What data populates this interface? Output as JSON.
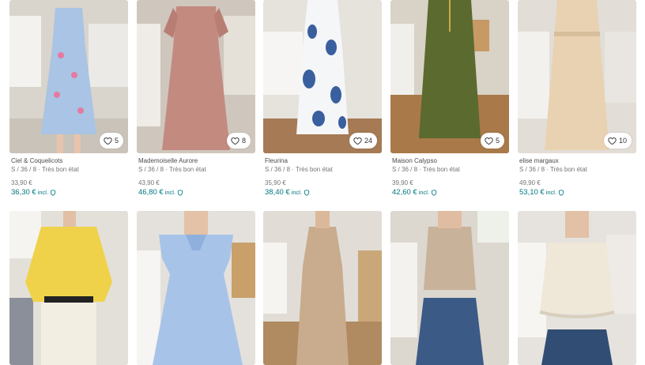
{
  "accent_color": "#007782",
  "items": [
    {
      "brand": "Ciel & Coquelicots",
      "details": "S / 36 / 8 · Très bon état",
      "price": "33,90 €",
      "price_incl": "36,30 €",
      "incl_label": "incl.",
      "favorites": "5",
      "colors": {
        "bg": "#d9d4cc",
        "garment": "#a9c4e4"
      }
    },
    {
      "brand": "Mademoiselle Aurore",
      "details": "S / 36 / 8 · Très bon état",
      "price": "43,90 €",
      "price_incl": "46,80 €",
      "incl_label": "incl.",
      "favorites": "8",
      "colors": {
        "bg": "#cfc7bd",
        "garment": "#c38a80"
      }
    },
    {
      "brand": "Fleurina",
      "details": "S / 36 / 8 · Très bon état",
      "price": "35,90 €",
      "price_incl": "38,40 €",
      "incl_label": "incl.",
      "favorites": "24",
      "colors": {
        "bg": "#e6e2dc",
        "garment": "#3a5f9e"
      }
    },
    {
      "brand": "Maison Calypso",
      "details": "S / 36 / 8 · Très bon état",
      "price": "39,90 €",
      "price_incl": "42,60 €",
      "incl_label": "incl.",
      "favorites": "5",
      "colors": {
        "bg": "#d8d2c7",
        "garment": "#5b6a2e"
      }
    },
    {
      "brand": "elise margaux",
      "details": "S / 36 / 8 · Très bon état",
      "price": "49,90 €",
      "price_incl": "53,10 €",
      "incl_label": "incl.",
      "favorites": "10",
      "colors": {
        "bg": "#e2ddd6",
        "garment": "#e8d2b2"
      }
    }
  ],
  "items_row2": [
    {
      "colors": {
        "bg": "#e3e0da",
        "garment": "#f0d24a"
      }
    },
    {
      "colors": {
        "bg": "#e4e1dc",
        "garment": "#a8c3e8"
      }
    },
    {
      "colors": {
        "bg": "#e1ddd6",
        "garment": "#c9ab8d"
      }
    },
    {
      "colors": {
        "bg": "#dcd7cf",
        "garment": "#c9b29a"
      }
    },
    {
      "colors": {
        "bg": "#e6e3de",
        "garment": "#efe7d8"
      }
    }
  ]
}
